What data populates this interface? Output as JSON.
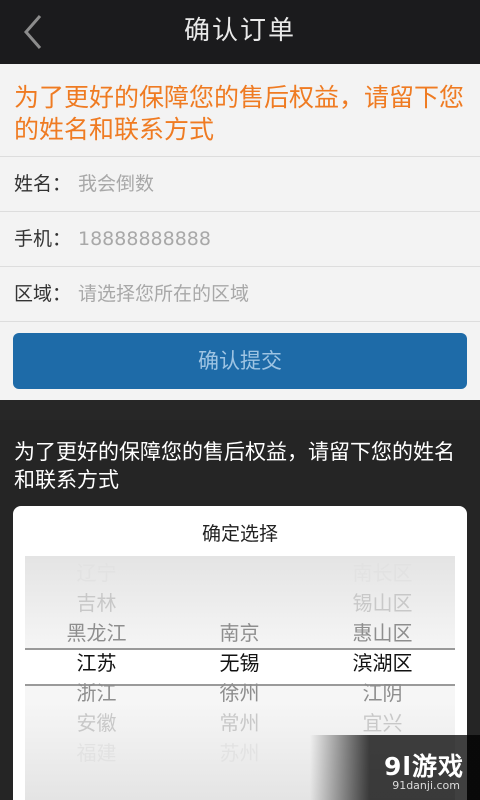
{
  "header": {
    "title": "确认订单",
    "back_icon": "chevron-left-icon"
  },
  "notice": "为了更好的保障您的售后权益，请留下您的姓名和联系方式",
  "form": {
    "name_label": "姓名：",
    "name_value": "我会倒数",
    "phone_label": "手机：",
    "phone_value": "18888888888",
    "region_label": "区域：",
    "region_placeholder": "请选择您所在的区域"
  },
  "submit_label": "确认提交",
  "overlay_notice": "为了更好的保障您的售后权益，请留下您的姓名和联系方式",
  "picker": {
    "title": "确定选择",
    "provinces": [
      "辽宁",
      "吉林",
      "黑龙江",
      "江苏",
      "浙江",
      "安徽",
      "福建"
    ],
    "cities": [
      "南京",
      "无锡",
      "徐州",
      "常州",
      "苏州"
    ],
    "districts": [
      "南长区",
      "锡山区",
      "惠山区",
      "滨湖区",
      "江阴",
      "宜兴"
    ],
    "selected": {
      "province": "江苏",
      "city": "无锡",
      "district": "滨湖区"
    }
  },
  "watermark": {
    "logo": "9l游戏",
    "site": "91danji.com"
  },
  "colors": {
    "accent_orange": "#ef7b22",
    "button_blue": "#1e6ba8",
    "header_dark": "#1b1b1d"
  }
}
